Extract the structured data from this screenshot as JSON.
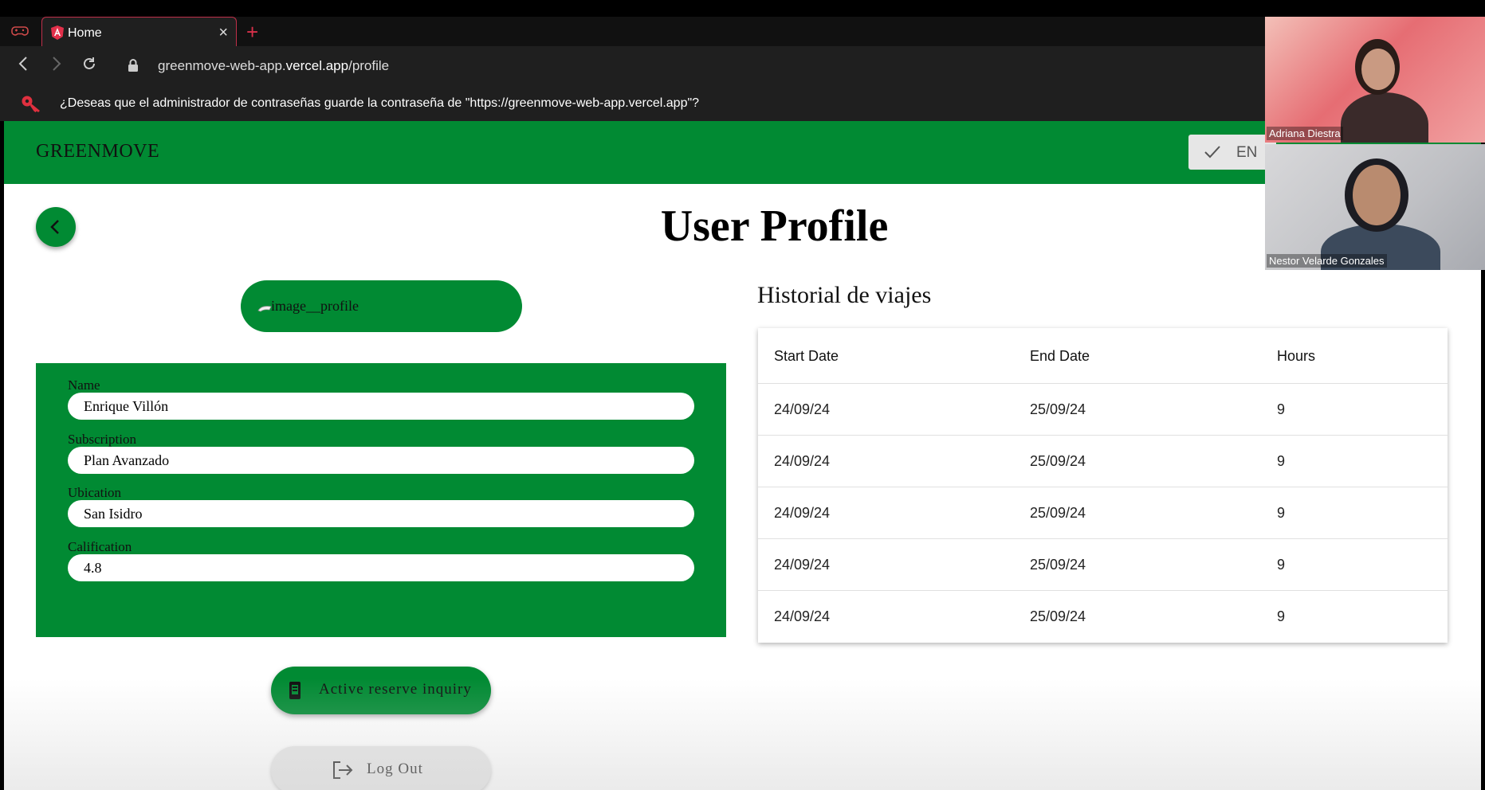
{
  "browser": {
    "tab_title": "Home",
    "url_prefix": "greenmove-web-app.",
    "url_domain": "vercel.app",
    "url_path": "/profile",
    "password_prompt": "¿Deseas que el administrador de contraseñas guarde la contraseña de \"https://greenmove-web-app.vercel.app\"?"
  },
  "header": {
    "brand": "GREENMOVE",
    "language": "EN"
  },
  "page": {
    "title": "User Profile",
    "profile_image_alt": "image__profile"
  },
  "profile": {
    "fields": [
      {
        "label": "Name",
        "value": "Enrique Villón"
      },
      {
        "label": "Subscription",
        "value": "Plan Avanzado"
      },
      {
        "label": "Ubication",
        "value": "San Isidro"
      },
      {
        "label": "Calification",
        "value": "4.8"
      }
    ]
  },
  "actions": {
    "reserve_label": "Active reserve inquiry",
    "logout_label": "Log Out"
  },
  "history": {
    "title": "Historial de viajes",
    "columns": [
      "Start Date",
      "End Date",
      "Hours"
    ],
    "rows": [
      [
        "24/09/24",
        "25/09/24",
        "9"
      ],
      [
        "24/09/24",
        "25/09/24",
        "9"
      ],
      [
        "24/09/24",
        "25/09/24",
        "9"
      ],
      [
        "24/09/24",
        "25/09/24",
        "9"
      ],
      [
        "24/09/24",
        "25/09/24",
        "9"
      ]
    ]
  },
  "video_call": {
    "participants": [
      {
        "name": "Adriana Diestra"
      },
      {
        "name": "Nestor Velarde Gonzales"
      }
    ]
  },
  "colors": {
    "brand_green": "#018a33",
    "tab_accent": "#c0304a"
  }
}
